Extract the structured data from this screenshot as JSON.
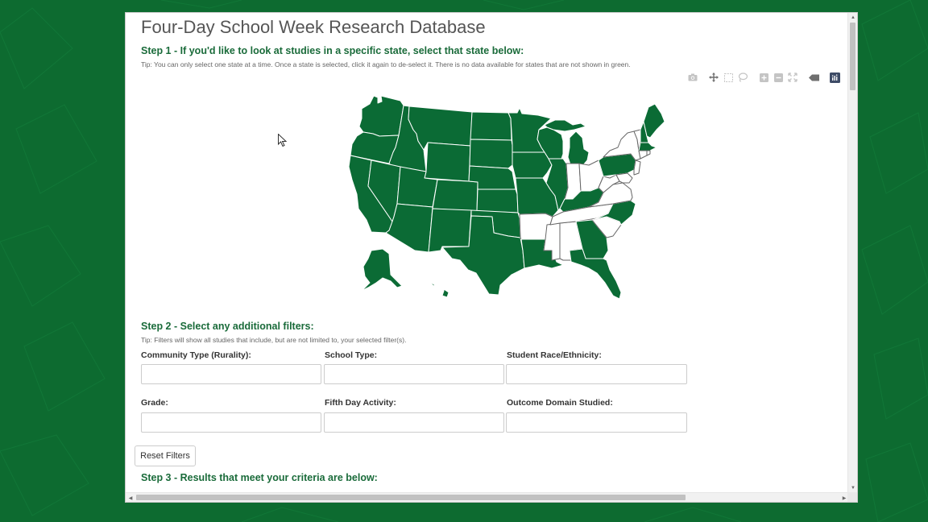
{
  "page": {
    "title": "Four-Day School Week Research Database"
  },
  "step1": {
    "heading": "Step 1 - If you'd like to look at studies in a specific state, select that state below:",
    "tip": "Tip: You can only select one state at a time. Once a state is selected, click it again to de-select it. There is no data available for states that are not shown in green."
  },
  "map_toolbar": {
    "tools": [
      "camera-icon",
      "pan-icon",
      "box-select-icon",
      "lasso-select-icon",
      "zoom-in-icon",
      "zoom-out-icon",
      "autoscale-icon",
      "reset-icon",
      "plotly-logo-icon"
    ]
  },
  "map": {
    "green_color": "#0b6b35",
    "white_color": "#ffffff",
    "states_with_data": [
      "WA",
      "OR",
      "CA",
      "ID",
      "NV",
      "MT",
      "WY",
      "UT",
      "AZ",
      "CO",
      "NM",
      "ND",
      "SD",
      "NE",
      "KS",
      "OK",
      "TX",
      "MN",
      "IA",
      "MO",
      "WI",
      "MI",
      "IL",
      "KY",
      "LA",
      "GA",
      "FL",
      "NC",
      "PA",
      "ME",
      "NH",
      "MA",
      "AK",
      "HI"
    ],
    "states_without_data": [
      "AR",
      "MS",
      "AL",
      "TN",
      "IN",
      "OH",
      "WV",
      "VA",
      "NY",
      "SC",
      "VT",
      "CT",
      "RI",
      "NJ",
      "DE",
      "MD"
    ]
  },
  "step2": {
    "heading": "Step 2 - Select any additional filters:",
    "tip": "Tip: Filters will show all studies that include, but are not limited to, your selected filter(s).",
    "filters": [
      {
        "label": "Community Type (Rurality):",
        "value": ""
      },
      {
        "label": "School Type:",
        "value": ""
      },
      {
        "label": "Student Race/Ethnicity:",
        "value": ""
      },
      {
        "label": "Grade:",
        "value": ""
      },
      {
        "label": "Fifth Day Activity:",
        "value": ""
      },
      {
        "label": "Outcome Domain Studied:",
        "value": ""
      }
    ],
    "reset_label": "Reset Filters"
  },
  "step3": {
    "heading": "Step 3 - Results that meet your criteria are below:"
  }
}
